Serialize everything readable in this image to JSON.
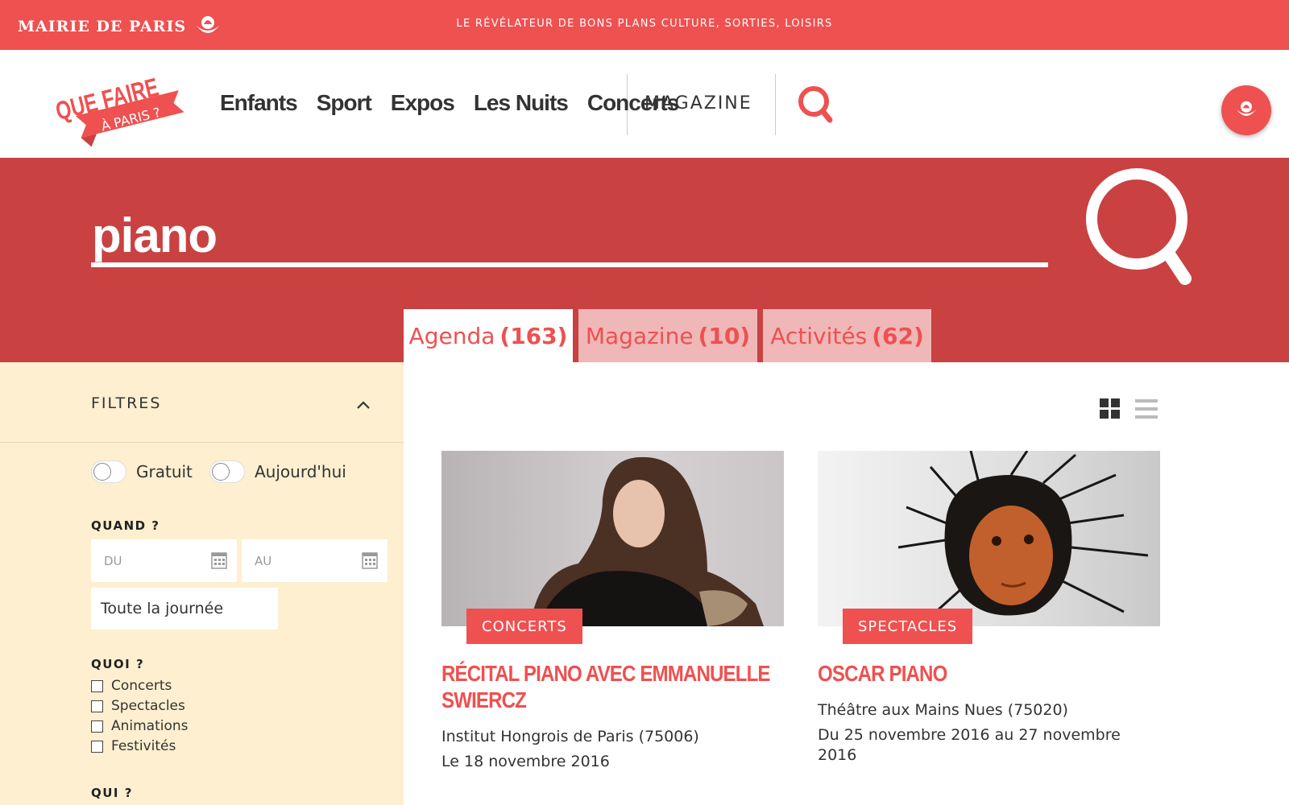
{
  "topbar": {
    "brand": "MAIRIE DE PARIS",
    "tagline": "LE RÉVÉLATEUR DE BONS PLANS CULTURE, SORTIES, LOISIRS"
  },
  "logo": {
    "line1": "QUE FAIRE",
    "line2": "À PARIS ?"
  },
  "nav": {
    "links": [
      "Enfants",
      "Sport",
      "Expos",
      "Les Nuits",
      "Concerts"
    ],
    "magazine": "MAGAZINE"
  },
  "search": {
    "query": "piano"
  },
  "tabs": [
    {
      "label": "Agenda",
      "count": "(163)"
    },
    {
      "label": "Magazine",
      "count": "(10)"
    },
    {
      "label": "Activités",
      "count": "(62)"
    }
  ],
  "filters": {
    "title": "FILTRES",
    "toggles": [
      "Gratuit",
      "Aujourd'hui"
    ],
    "quand": "QUAND ?",
    "du": "DU",
    "au": "AU",
    "allday": "Toute la journée",
    "quoi": "QUOI ?",
    "categories": [
      "Concerts",
      "Spectacles",
      "Animations",
      "Festivités"
    ],
    "qui": "QUI ?"
  },
  "cards": [
    {
      "badge": "CONCERTS",
      "title": "RÉCITAL PIANO AVEC EMMANUELLE SWIERCZ",
      "place": "Institut Hongrois de Paris (75006)",
      "date": "Le 18 novembre 2016"
    },
    {
      "badge": "SPECTACLES",
      "title": "OSCAR PIANO",
      "place": "Théâtre aux Mains Nues (75020)",
      "date": "Du 25 novembre 2016 au 27 novembre 2016"
    }
  ],
  "colors": {
    "brand": "#ef5050",
    "hero": "#c94141",
    "sidebar": "#fdefcf",
    "tab_inactive": "#efb7b7"
  }
}
